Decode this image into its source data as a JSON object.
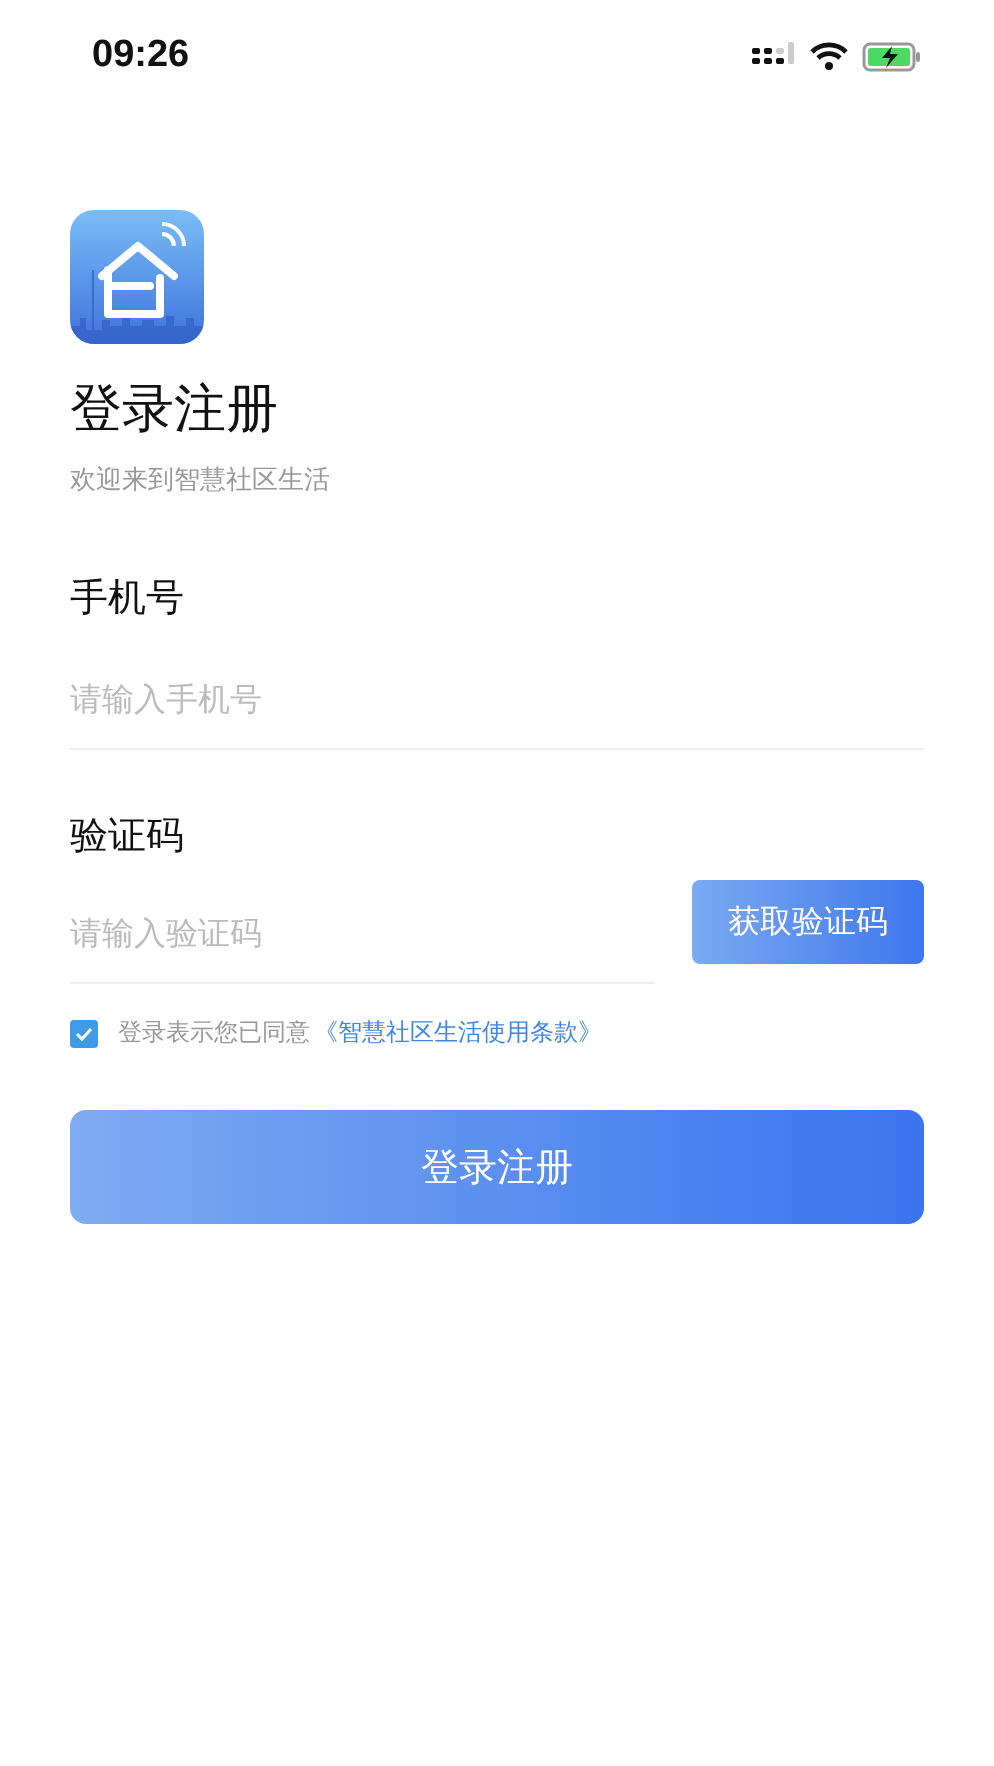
{
  "status_bar": {
    "time": "09:26"
  },
  "header": {
    "title": "登录注册",
    "subtitle": "欢迎来到智慧社区生活"
  },
  "phone": {
    "label": "手机号",
    "placeholder": "请输入手机号"
  },
  "code": {
    "label": "验证码",
    "placeholder": "请输入验证码",
    "button": "获取验证码"
  },
  "agreement": {
    "checked": true,
    "text": "登录表示您已同意",
    "link": "《智慧社区生活使用条款》"
  },
  "submit": "登录注册"
}
